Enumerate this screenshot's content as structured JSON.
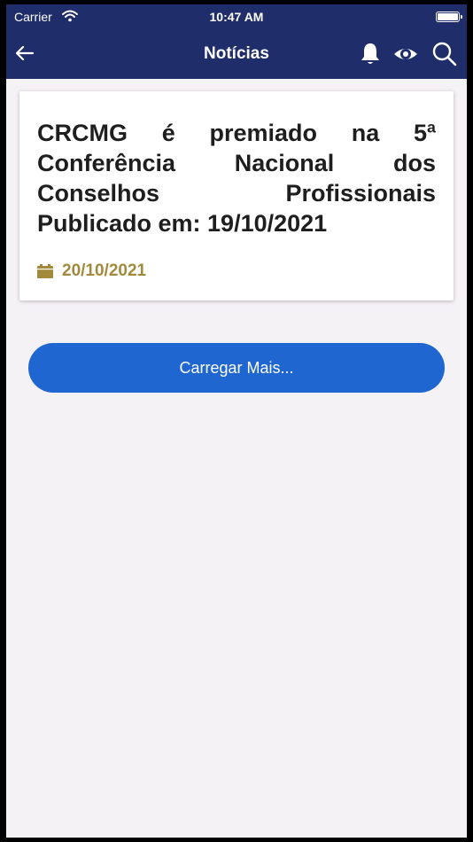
{
  "status_bar": {
    "carrier": "Carrier",
    "time": "10:47 AM",
    "wifi_icon": "wifi-icon",
    "battery_icon": "battery-icon"
  },
  "header": {
    "title": "Notícias",
    "back_icon": "arrow-left-icon",
    "actions": [
      "bell-icon",
      "eye-icon",
      "search-icon"
    ],
    "background_color": "#1f2d6b"
  },
  "news": [
    {
      "title": "CRCMG é premiado na 5ª Conferência Nacional dos Conselhos Profissionais Publicado em: 19/10/2021",
      "date": "20/10/2021",
      "date_icon": "calendar-icon",
      "date_color": "#a28a3c"
    }
  ],
  "load_more": {
    "label": "Carregar Mais...",
    "color": "#1f66d1"
  },
  "page_background": "#f5f2f6"
}
